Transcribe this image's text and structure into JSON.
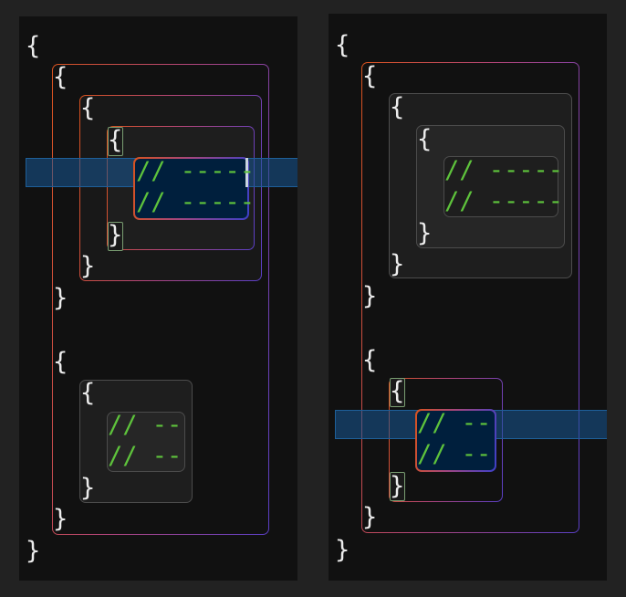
{
  "colors": {
    "background": "#222222",
    "panel": "#111111",
    "brace_text": "#ececec",
    "comment_text": "#5ec33c",
    "gradient_start": "#d9531e",
    "gradient_end": "#5a3fc6",
    "line_highlight": "#185896",
    "bracket_match_border": "#7a9e72"
  },
  "icons": {
    "text_caret": "caret-icon"
  },
  "left_editor": {
    "outer_open": "{",
    "outer_close": "}",
    "block1": {
      "open": "{",
      "close": "}",
      "inner": {
        "open": "{",
        "close": "}",
        "deep": {
          "open": "{",
          "close": "}",
          "line1": "// -----",
          "line2": "// -----"
        }
      }
    },
    "block2": {
      "open": "{",
      "close": "}",
      "inner": {
        "open": "{",
        "close": "}",
        "line1": "// --",
        "line2": "// --"
      }
    }
  },
  "right_editor": {
    "outer_open": "{",
    "outer_close": "}",
    "block1": {
      "open": "{",
      "close": "}",
      "inner": {
        "open": "{",
        "close": "}",
        "deep": {
          "open": "{",
          "close": "}",
          "line1": "// -----",
          "line2": "// -----"
        }
      }
    },
    "block2": {
      "open": "{",
      "close": "}",
      "inner": {
        "open": "{",
        "close": "}",
        "line1": "// --",
        "line2": "// --"
      }
    }
  }
}
